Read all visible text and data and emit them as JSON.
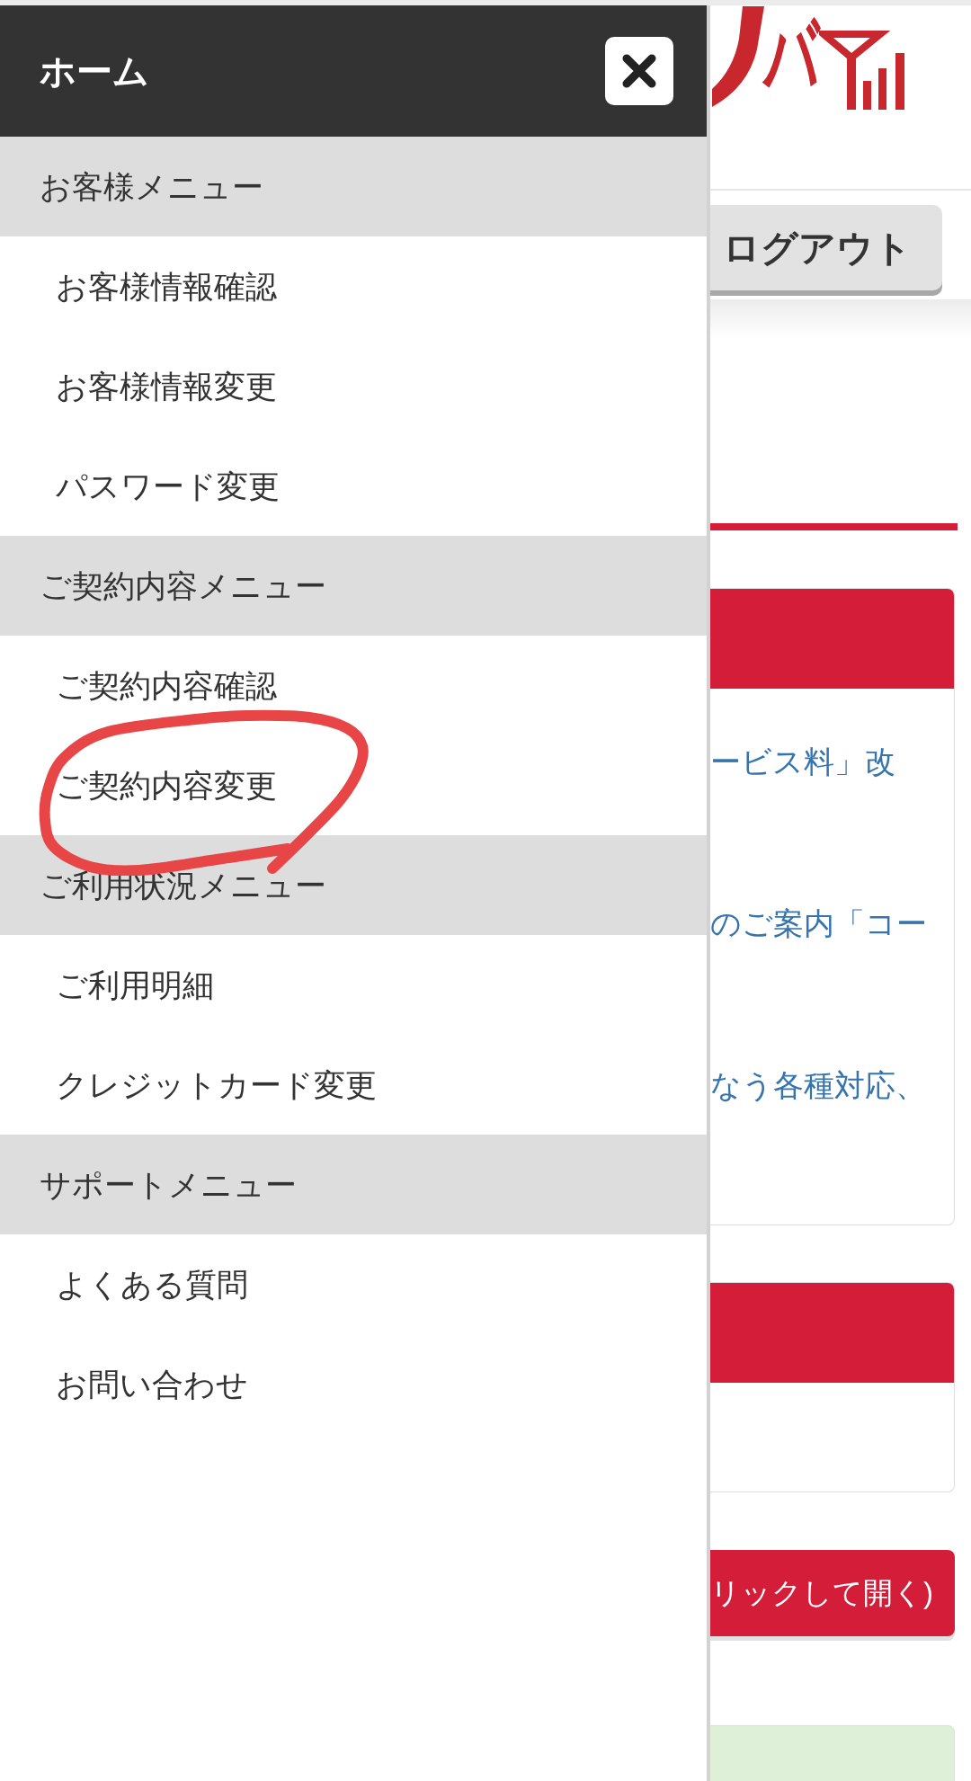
{
  "drawer": {
    "title": "ホーム",
    "sections": [
      {
        "heading": "お客様メニュー",
        "items": [
          {
            "label": "お客様情報確認",
            "circled": false
          },
          {
            "label": "お客様情報変更",
            "circled": false
          },
          {
            "label": "パスワード変更",
            "circled": false
          }
        ]
      },
      {
        "heading": "ご契約内容メニュー",
        "items": [
          {
            "label": "ご契約内容確認",
            "circled": false
          },
          {
            "label": "ご契約内容変更",
            "circled": true
          }
        ]
      },
      {
        "heading": "ご利用状況メニュー",
        "items": [
          {
            "label": "ご利用明細",
            "circled": false
          },
          {
            "label": "クレジットカード変更",
            "circled": false
          }
        ]
      },
      {
        "heading": "サポートメニュー",
        "items": [
          {
            "label": "よくある質問",
            "circled": false
          },
          {
            "label": "お問い合わせ",
            "circled": false
          }
        ]
      }
    ]
  },
  "page": {
    "logo": {
      "text": "バ"
    },
    "logout_button": "ログアウト",
    "blocks": [
      {
        "kind": "card",
        "links": [
          "ービス料」改",
          "のご案内「コー",
          "なう各種対応、"
        ]
      },
      {
        "kind": "card"
      },
      {
        "kind": "button",
        "label": "リックして開く)"
      },
      {
        "kind": "notice"
      }
    ]
  }
}
